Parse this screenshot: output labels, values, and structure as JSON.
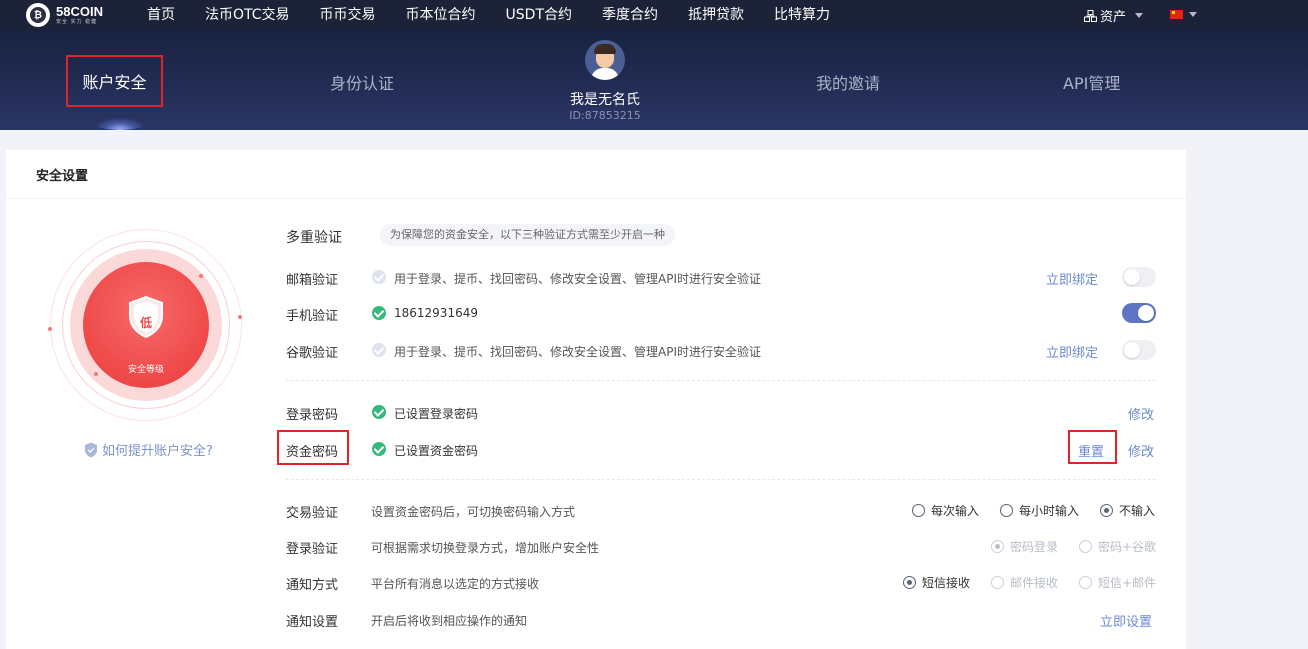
{
  "nav": {
    "logo_text": "58COIN",
    "logo_subtitle": "安全 实力 稳健",
    "links": [
      "首页",
      "法币OTC交易",
      "币币交易",
      "币本位合约",
      "USDT合约",
      "季度合约",
      "抵押贷款",
      "比特算力"
    ],
    "assets_label": "资产",
    "language": "中文"
  },
  "banner": {
    "tabs": {
      "account_security": "账户安全",
      "identity": "身份认证",
      "invites": "我的邀请",
      "api": "API管理"
    },
    "username": "我是无名氏",
    "user_id": "ID:87853215"
  },
  "security": {
    "title": "安全设置",
    "level_letter": "低",
    "level_caption": "安全等级",
    "improve_link": "如何提升账户安全?",
    "multi_verify": {
      "label": "多重验证",
      "hint": "为保障您的资金安全，以下三种验证方式需至少开启一种"
    },
    "email": {
      "label": "邮箱验证",
      "desc": "用于登录、提币、找回密码、修改安全设置、管理API时进行安全验证",
      "action": "立即绑定",
      "enabled": false
    },
    "phone": {
      "label": "手机验证",
      "desc": "18612931649",
      "enabled": true
    },
    "google": {
      "label": "谷歌验证",
      "desc": "用于登录、提币、找回密码、修改安全设置、管理API时进行安全验证",
      "action": "立即绑定",
      "enabled": false
    },
    "login_password": {
      "label": "登录密码",
      "desc": "已设置登录密码",
      "modify": "修改"
    },
    "fund_password": {
      "label": "资金密码",
      "desc": "已设置资金密码",
      "reset": "重置",
      "modify": "修改"
    },
    "trade_verify": {
      "label": "交易验证",
      "desc": "设置资金密码后，可切换密码输入方式",
      "options": [
        "每次输入",
        "每小时输入",
        "不输入"
      ],
      "selected": "不输入"
    },
    "login_verify": {
      "label": "登录验证",
      "desc": "可根据需求切换登录方式，增加账户安全性",
      "options": [
        "密码登录",
        "密码+谷歌"
      ],
      "selected": "密码登录"
    },
    "notify_method": {
      "label": "通知方式",
      "desc": "平台所有消息以选定的方式接收",
      "options": [
        "短信接收",
        "邮件接收",
        "短信+邮件"
      ],
      "selected": "短信接收"
    },
    "notify_settings": {
      "label": "通知设置",
      "desc": "开启后将收到相应操作的通知",
      "action": "立即设置"
    }
  },
  "colors": {
    "nav_bg": "#1c2237",
    "accent_red": "#ef4848",
    "link_blue": "#6c8bd2",
    "success_green": "#35b87b",
    "highlight_red": "#e0252a"
  }
}
